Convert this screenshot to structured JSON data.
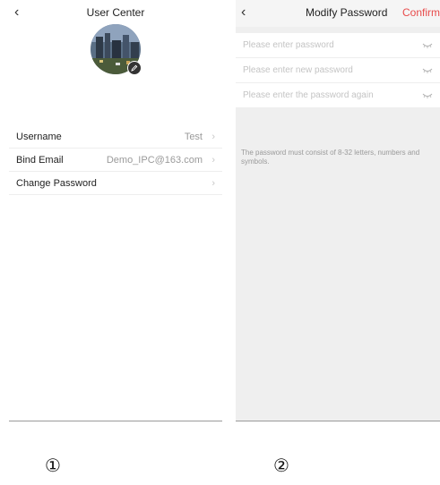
{
  "screen1": {
    "title": "User Center",
    "menu": [
      {
        "label": "Username",
        "value": "Test"
      },
      {
        "label": "Bind Email",
        "value": "Demo_IPC@163.com"
      },
      {
        "label": "Change Password",
        "value": ""
      }
    ]
  },
  "screen2": {
    "title": "Modify Password",
    "confirm_label": "Confirm",
    "fields": [
      {
        "placeholder": "Please enter password"
      },
      {
        "placeholder": "Please enter new password"
      },
      {
        "placeholder": "Please enter the password again"
      }
    ],
    "hint": "The password must consist of 8-32 letters, numbers and symbols."
  },
  "captions": [
    "①",
    "②"
  ],
  "colors": {
    "accent": "#e84b4b",
    "background": "#efefef",
    "divider": "#eeeeee"
  },
  "icons": [
    "back-arrow-icon",
    "chevron-right-icon",
    "edit-pencil-icon",
    "eye-closed-icon"
  ]
}
